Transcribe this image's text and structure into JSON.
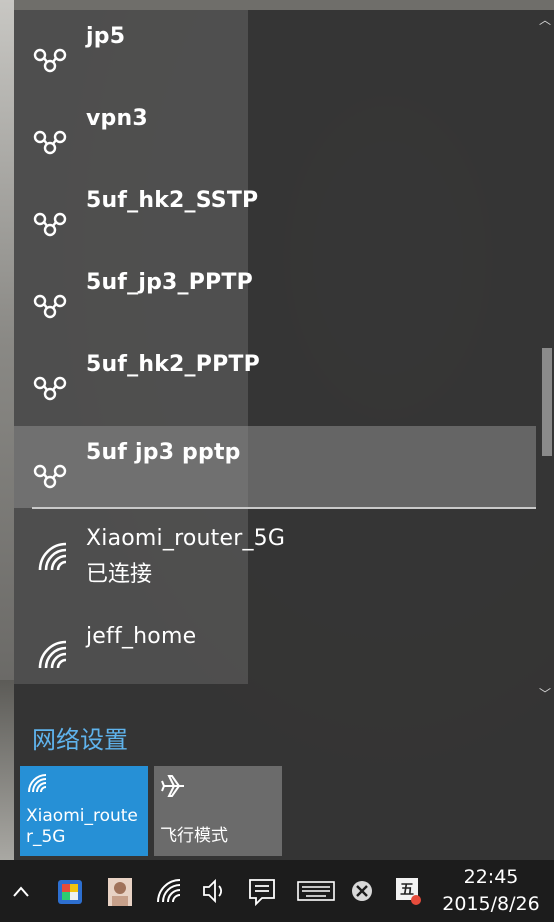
{
  "vpn_list": [
    {
      "name": "jp5",
      "icon": "vpn-icon"
    },
    {
      "name": "vpn3",
      "icon": "vpn-icon"
    },
    {
      "name": "5uf_hk2_SSTP",
      "icon": "vpn-icon"
    },
    {
      "name": "5uf_jp3_PPTP",
      "icon": "vpn-icon"
    },
    {
      "name": "5uf_hk2_PPTP",
      "icon": "vpn-icon"
    },
    {
      "name": "5uf jp3 pptp",
      "icon": "vpn-icon",
      "selected": true
    }
  ],
  "wifi_list": [
    {
      "name": "Xiaomi_router_5G",
      "status": "已连接",
      "icon": "wifi-icon"
    },
    {
      "name": "jeff_home",
      "status": "",
      "icon": "wifi-icon"
    }
  ],
  "settings_link": "网络设置",
  "quick_actions": {
    "wifi_tile": {
      "label": "Xiaomi_router_5G",
      "icon": "wifi-icon",
      "active": true,
      "color": "#2690d6"
    },
    "airplane_tile": {
      "label": "飞行模式",
      "icon": "airplane-icon",
      "active": false,
      "color": "#6b6b6b"
    }
  },
  "taskbar": {
    "time": "22:45",
    "date": "2015/8/26",
    "icons": [
      "chevron-up-icon",
      "app-icon",
      "user-avatar-icon",
      "network-icon",
      "volume-icon",
      "action-center-icon",
      "keyboard-icon",
      "close-circle-icon",
      "ime-icon"
    ]
  },
  "colors": {
    "accent": "#2690d6",
    "link": "#5fb3ec",
    "panel_bg": "#343434",
    "taskbar_bg": "#1c1c1c"
  }
}
